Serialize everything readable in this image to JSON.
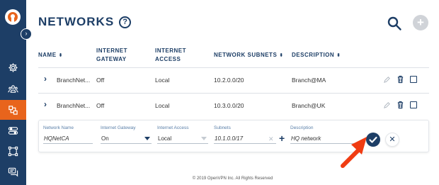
{
  "header": {
    "title": "NETWORKS",
    "help_icon": "?"
  },
  "table": {
    "headers": [
      {
        "key": "name",
        "label": "NAME"
      },
      {
        "key": "gateway",
        "label": "INTERNET GATEWAY"
      },
      {
        "key": "access",
        "label": "INTERNET ACCESS"
      },
      {
        "key": "subnets",
        "label": "NETWORK SUBNETS"
      },
      {
        "key": "description",
        "label": "DESCRIPTION"
      }
    ],
    "rows": [
      {
        "name": "BranchNet...",
        "gateway": "Off",
        "access": "Local",
        "subnets": "10.2.0.0/20",
        "description": "Branch@MA"
      },
      {
        "name": "BranchNet...",
        "gateway": "Off",
        "access": "Local",
        "subnets": "10.3.0.0/20",
        "description": "Branch@UK"
      }
    ]
  },
  "form": {
    "name_label": "Network Name",
    "name_value": "HQNetCA",
    "gateway_label": "Internet Gateway",
    "gateway_value": "On",
    "access_label": "Internet Access",
    "access_value": "Local",
    "subnets_label": "Subnets",
    "subnets_value": "10.1.0.0/17",
    "description_label": "Description",
    "description_value": "HQ network"
  },
  "footer": {
    "text": "© 2019 OpenVPN Inc. All Rights Reserved"
  },
  "colors": {
    "sidebar": "#1d3e66",
    "accent": "#e8641c",
    "arrow": "#f03c12"
  },
  "icons": {
    "sidebar": [
      "settings-icon",
      "users-icon",
      "networks-icon",
      "toggles-icon",
      "topology-icon",
      "messages-icon"
    ]
  }
}
